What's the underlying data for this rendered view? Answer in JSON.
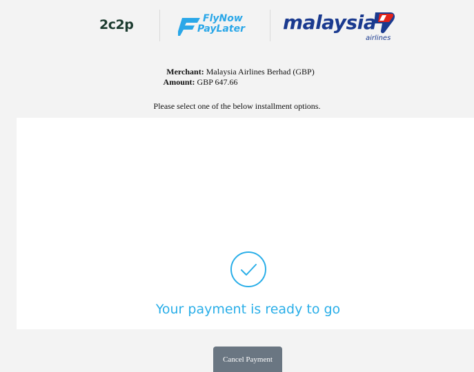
{
  "header": {
    "logos": {
      "provider": "2c2p",
      "bnpl_line1": "FlyNow",
      "bnpl_line2": "PayLater",
      "airline": "malaysia",
      "airline_sub": "airlines"
    }
  },
  "merchant": {
    "merchant_label": "Merchant:",
    "merchant_value": "Malaysia Airlines Berhad (GBP)",
    "amount_label": "Amount:",
    "amount_value": "GBP 647.66"
  },
  "instructions": "Please select one of the below installment options.",
  "status": {
    "icon": "check-circle-icon",
    "message": "Your payment is ready to go"
  },
  "actions": {
    "cancel_label": "Cancel Payment"
  },
  "colors": {
    "accent": "#29aee8",
    "airline_blue": "#1a3a8f",
    "airline_red": "#e2231a",
    "button_gray": "#6a7682",
    "provider_green": "#1c3b2f"
  }
}
